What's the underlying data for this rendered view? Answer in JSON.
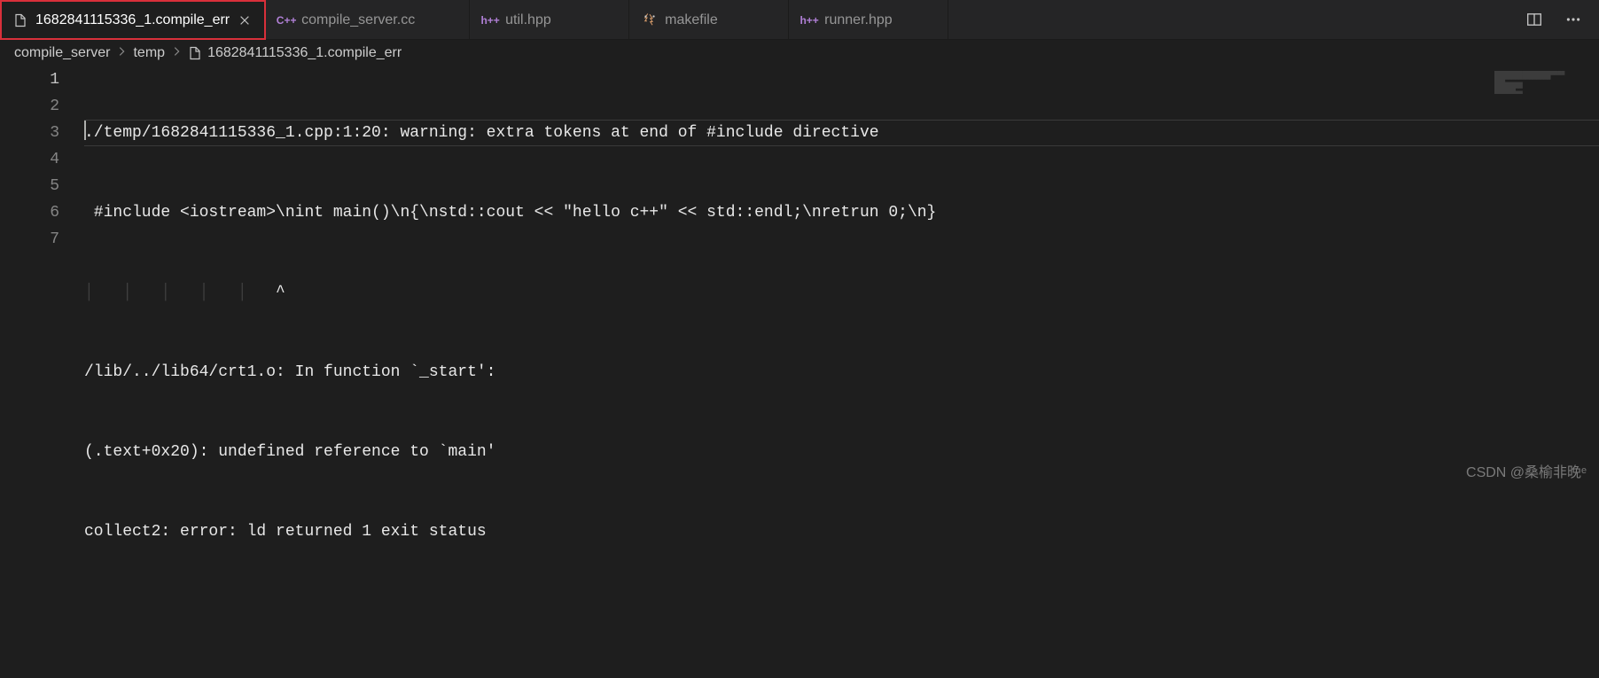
{
  "tabs": [
    {
      "label": "1682841115336_1.compile_err",
      "icon": "file-icon",
      "active": true,
      "closable": true
    },
    {
      "label": "compile_server.cc",
      "icon": "cpp-icon",
      "active": false,
      "closable": false,
      "prefix": "C++"
    },
    {
      "label": "util.hpp",
      "icon": "hpp-icon",
      "active": false,
      "closable": false,
      "prefix": "h++"
    },
    {
      "label": "makefile",
      "icon": "makefile-icon",
      "active": false,
      "closable": false
    },
    {
      "label": "runner.hpp",
      "icon": "hpp-icon",
      "active": false,
      "closable": false,
      "prefix": "h++"
    }
  ],
  "breadcrumb": {
    "seg0": "compile_server",
    "seg1": "temp",
    "seg2": "1682841115336_1.compile_err"
  },
  "editor": {
    "lines": {
      "l1": "./temp/1682841115336_1.cpp:1:20: warning: extra tokens at end of #include directive",
      "l2": " #include <iostream>\\nint main()\\n{\\nstd::cout << \"hello c++\" << std::endl;\\nretrun 0;\\n}",
      "l3": "                    ^",
      "l4": "/lib/../lib64/crt1.o: In function `_start':",
      "l5": "(.text+0x20): undefined reference to `main'",
      "l6": "collect2: error: ld returned 1 exit status",
      "l7": ""
    },
    "line_numbers": {
      "n1": "1",
      "n2": "2",
      "n3": "3",
      "n4": "4",
      "n5": "5",
      "n6": "6",
      "n7": "7"
    }
  },
  "watermark": "CSDN @桑榆非晚ᵉ"
}
